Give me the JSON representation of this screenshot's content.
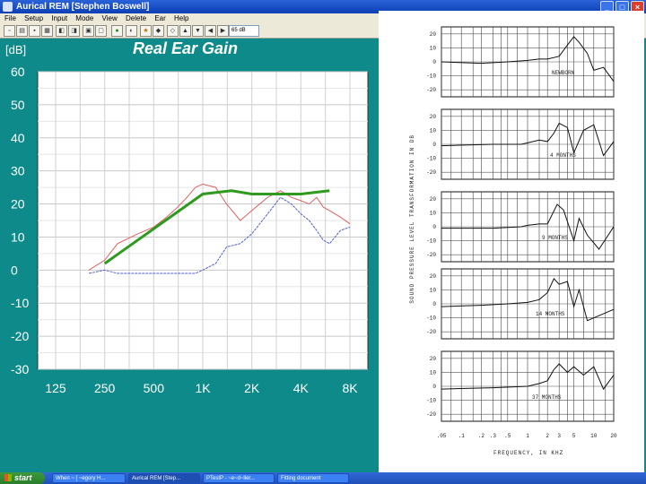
{
  "window": {
    "title": "Aurical REM [Stephen Boswell]"
  },
  "menu": [
    "File",
    "Setup",
    "Input",
    "Mode",
    "View",
    "Delete",
    "Ear",
    "Help"
  ],
  "toolbar": {
    "level_select": "65 dB"
  },
  "plot": {
    "title": "Real Ear Gain",
    "unit_label": "[dB]",
    "chart_data": {
      "type": "line",
      "title": "Real Ear Gain",
      "ylabel": "[dB]",
      "xscale": "log",
      "xticks": [
        125,
        250,
        500,
        1000,
        2000,
        4000,
        8000
      ],
      "xtick_labels": [
        "125",
        "250",
        "500",
        "1K",
        "2K",
        "4K",
        "8K"
      ],
      "yticks": [
        60,
        50,
        40,
        30,
        20,
        10,
        0,
        -10,
        -20,
        -30
      ],
      "ylim": [
        -30,
        60
      ],
      "grid": true,
      "series": [
        {
          "color": "#e06060",
          "x": [
            200,
            250,
            300,
            400,
            500,
            600,
            700,
            800,
            900,
            1000,
            1200,
            1400,
            1700,
            2000,
            2500,
            3000,
            3500,
            4000,
            4500,
            5000,
            5500,
            6000,
            7000,
            8000
          ],
          "y": [
            0,
            3,
            8,
            11,
            13,
            16,
            19,
            22,
            25,
            26,
            25,
            20,
            15,
            18,
            22,
            24,
            22,
            21,
            20,
            22,
            19,
            18,
            16,
            14
          ]
        },
        {
          "color": "#5060d0",
          "x": [
            200,
            250,
            300,
            400,
            500,
            600,
            700,
            800,
            900,
            1000,
            1200,
            1400,
            1700,
            2000,
            2500,
            3000,
            3500,
            4000,
            4500,
            5000,
            5500,
            6000,
            7000,
            8000
          ],
          "y": [
            -1,
            0,
            -1,
            -1,
            -1,
            -1,
            -1,
            -1,
            -1,
            0,
            2,
            7,
            8,
            11,
            17,
            22,
            20,
            17,
            15,
            12,
            9,
            8,
            12,
            13
          ]
        },
        {
          "color": "#2e9a1e",
          "x": [
            250,
            1000,
            1500,
            2000,
            3000,
            4000,
            6000
          ],
          "y": [
            2,
            23,
            24,
            23,
            23,
            23,
            24
          ]
        }
      ]
    }
  },
  "scan": {
    "panels": [
      "NEWBORN",
      "4 MONTHS",
      "9 MONTHS",
      "14 MONTHS",
      "37 MONTHS"
    ],
    "yticks": [
      "20",
      "10",
      "0",
      "-10",
      "-20"
    ],
    "xticks": [
      ".05",
      ".1",
      ".2",
      ".3",
      ".5",
      "1",
      "2",
      "3",
      "5",
      "10",
      "20"
    ],
    "ylabel": "SOUND PRESSURE LEVEL TRANSFORMATION IN DB",
    "xlabel": "FREQUENCY, IN KHZ"
  },
  "taskbar": {
    "start": "start",
    "items": [
      "When ~ [ ~egory H...",
      "Aurical REM [Step...",
      "PTestP - ~e~d~ller...",
      "Fitting document"
    ]
  }
}
